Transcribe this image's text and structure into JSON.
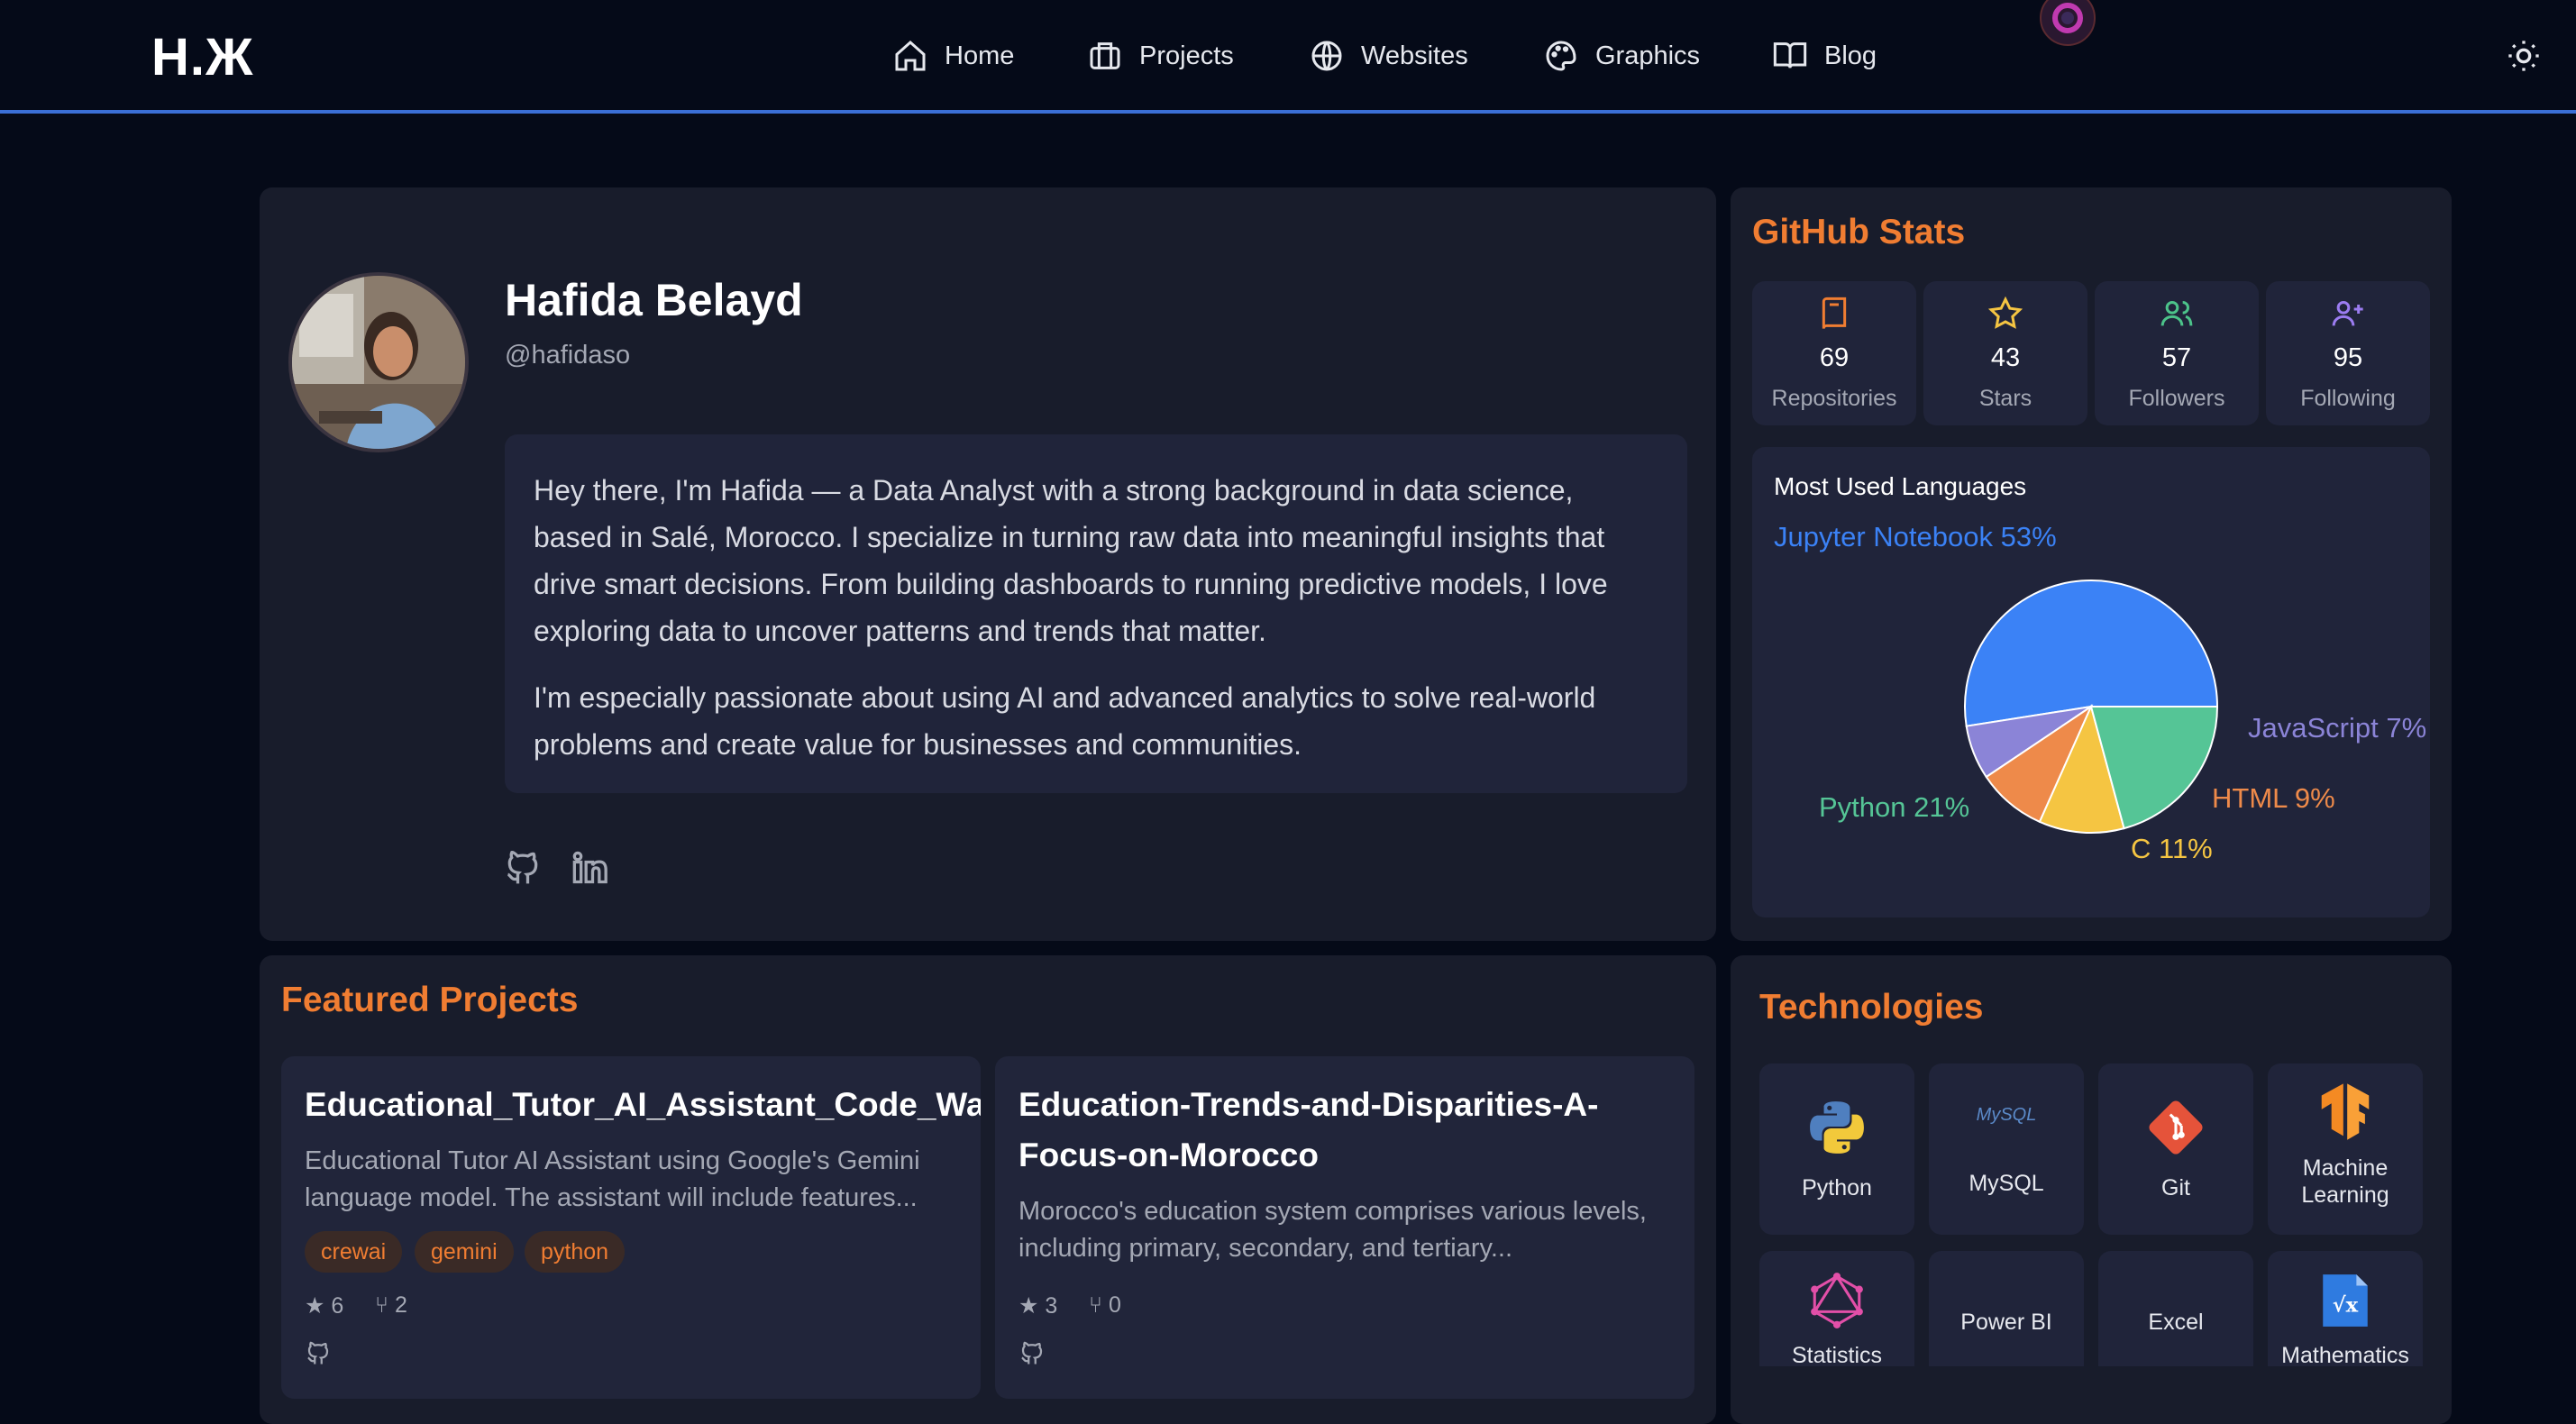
{
  "nav": {
    "logo": "H.Ж",
    "items": [
      {
        "label": "Home",
        "icon": "home-icon"
      },
      {
        "label": "Projects",
        "icon": "briefcase-icon"
      },
      {
        "label": "Websites",
        "icon": "globe-icon"
      },
      {
        "label": "Graphics",
        "icon": "palette-icon"
      },
      {
        "label": "Blog",
        "icon": "book-icon"
      }
    ],
    "theme_icon": "sun-icon"
  },
  "profile": {
    "name": "Hafida Belayd",
    "handle": "@hafidaso",
    "bio_1": "Hey there, I'm Hafida — a Data Analyst with a strong background in data science, based in Salé, Morocco. I specialize in turning raw data into meaningful insights that drive smart decisions. From building dashboards to running predictive models, I love exploring data to uncover patterns and trends that matter.",
    "bio_2": "I'm especially passionate about using AI and advanced analytics to solve real-world problems and create value for businesses and communities."
  },
  "github": {
    "title": "GitHub Stats",
    "stats": [
      {
        "value": "69",
        "label": "Repositories",
        "color": "#f07d32"
      },
      {
        "value": "43",
        "label": "Stars",
        "color": "#f5c542"
      },
      {
        "value": "57",
        "label": "Followers",
        "color": "#4cc38a"
      },
      {
        "value": "95",
        "label": "Following",
        "color": "#9b7cf0"
      }
    ],
    "languages_title": "Most Used Languages"
  },
  "chart_data": {
    "type": "pie",
    "title": "Most Used Languages",
    "slices": [
      {
        "label": "Jupyter Notebook 53%",
        "value": 53,
        "color": "#3b82f6"
      },
      {
        "label": "JavaScript 7%",
        "value": 7,
        "color": "#8b84d7"
      },
      {
        "label": "HTML 9%",
        "value": 9,
        "color": "#ee8a4a"
      },
      {
        "label": "C 11%",
        "value": 11,
        "color": "#f5c542"
      },
      {
        "label": "Python 21%",
        "value": 21,
        "color": "#55c596"
      }
    ]
  },
  "featured": {
    "title": "Featured Projects",
    "projects": [
      {
        "title": "Educational_Tutor_AI_Assistant_Code_Walkthrough",
        "desc": "Educational Tutor AI Assistant using Google's Gemini language model. The assistant will include features...",
        "tags": [
          "crewai",
          "gemini",
          "python"
        ],
        "stars": "6",
        "forks": "2"
      },
      {
        "title_1": "Education-Trends-and-Disparities-A-",
        "title_2": "Focus-on-Morocco",
        "desc": "Morocco's education system comprises various levels, including primary, secondary, and tertiary...",
        "stars": "3",
        "forks": "0"
      }
    ]
  },
  "technologies": {
    "title": "Technologies",
    "items": [
      {
        "label": "Python",
        "icon": "python-icon"
      },
      {
        "label": "MySQL",
        "icon": "mysql-icon",
        "icon_text": "MySQL"
      },
      {
        "label": "Git",
        "icon": "git-icon"
      },
      {
        "label_1": "Machine",
        "label_2": "Learning",
        "icon": "tensorflow-icon"
      },
      {
        "label": "Statistics",
        "icon": "statistics-icon"
      },
      {
        "label": "Power BI"
      },
      {
        "label": "Excel"
      },
      {
        "label": "Mathematics",
        "icon": "mathematics-icon"
      }
    ]
  }
}
